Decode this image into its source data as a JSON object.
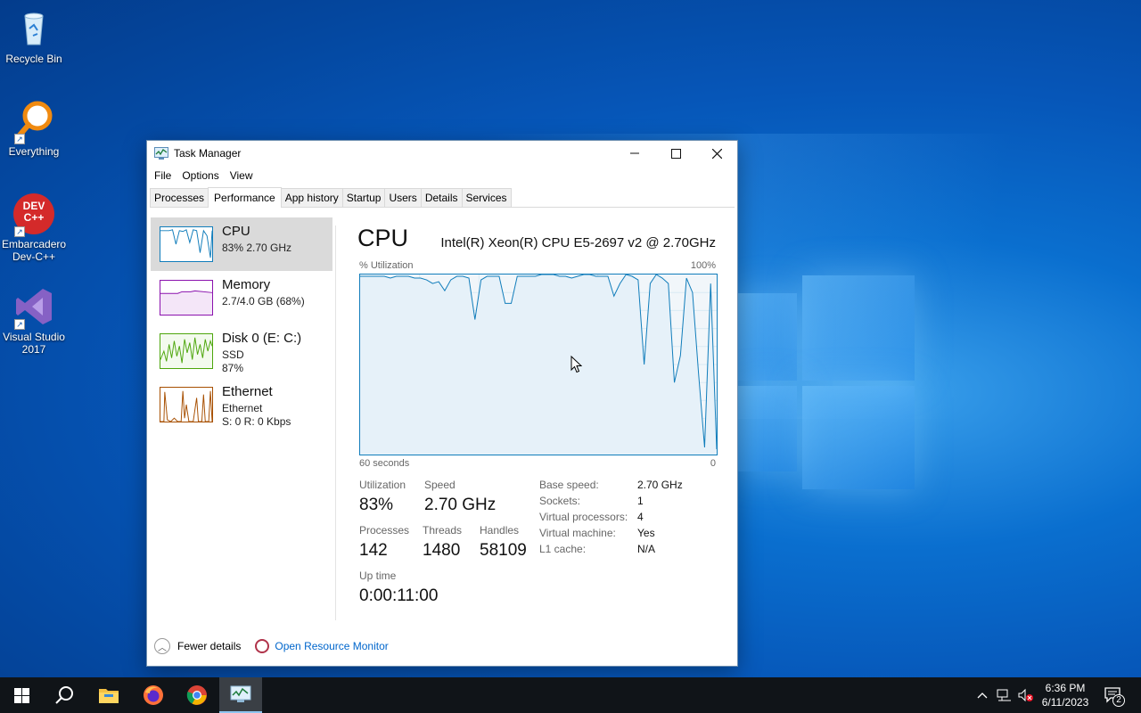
{
  "desktop": {
    "icons": [
      {
        "label": "Recycle Bin",
        "icon": "recycle-bin-icon"
      },
      {
        "label": "Everything",
        "icon": "everything-search-icon"
      },
      {
        "label": "Embarcadero Dev-C++",
        "icon": "devcpp-icon",
        "badge": "DEV C++"
      },
      {
        "label": "Visual Studio 2017",
        "icon": "visual-studio-icon"
      }
    ]
  },
  "window": {
    "title": "Task Manager",
    "menu": [
      "File",
      "Options",
      "View"
    ],
    "tabs": [
      "Processes",
      "Performance",
      "App history",
      "Startup",
      "Users",
      "Details",
      "Services"
    ],
    "active_tab": "Performance"
  },
  "sidebar": [
    {
      "name": "CPU",
      "line1": "83%  2.70 GHz",
      "color": "#117dbb",
      "selected": true
    },
    {
      "name": "Memory",
      "line1": "2.7/4.0 GB (68%)",
      "color": "#8b12ae"
    },
    {
      "name": "Disk 0 (E: C:)",
      "line1": "SSD",
      "line2": "87%",
      "color": "#4da60c"
    },
    {
      "name": "Ethernet",
      "line1": "Ethernet",
      "line2": "S: 0  R: 0 Kbps",
      "color": "#a74f01"
    }
  ],
  "cpu": {
    "title": "CPU",
    "model": "Intel(R) Xeon(R) CPU E5-2697 v2 @ 2.70GHz",
    "graph_label_left": "% Utilization",
    "graph_label_right": "100%",
    "axis_left": "60 seconds",
    "axis_right": "0",
    "utilization_label": "Utilization",
    "utilization": "83%",
    "speed_label": "Speed",
    "speed": "2.70 GHz",
    "processes_label": "Processes",
    "processes": "142",
    "threads_label": "Threads",
    "threads": "1480",
    "handles_label": "Handles",
    "handles": "58109",
    "uptime_label": "Up time",
    "uptime": "0:00:11:00",
    "details": [
      {
        "label": "Base speed:",
        "value": "2.70 GHz"
      },
      {
        "label": "Sockets:",
        "value": "1"
      },
      {
        "label": "Virtual processors:",
        "value": "4"
      },
      {
        "label": "Virtual machine:",
        "value": "Yes"
      },
      {
        "label": "L1 cache:",
        "value": "N/A"
      }
    ],
    "history_percent": [
      99,
      99,
      99,
      99,
      99,
      98,
      99,
      99,
      99,
      98,
      98,
      97,
      95,
      96,
      91,
      97,
      99,
      99,
      98,
      75,
      97,
      99,
      99,
      99,
      84,
      84,
      99,
      99,
      99,
      99,
      100,
      100,
      100,
      99,
      99,
      98,
      99,
      100,
      100,
      99,
      99,
      99,
      88,
      95,
      100,
      99,
      97,
      50,
      95,
      100,
      98,
      95,
      40,
      55,
      98,
      90,
      45,
      4,
      95,
      3
    ]
  },
  "footer": {
    "fewer_details": "Fewer details",
    "resource_monitor": "Open Resource Monitor"
  },
  "taskbar": {
    "time": "6:36 PM",
    "date": "6/11/2023",
    "notification_count": "2"
  }
}
